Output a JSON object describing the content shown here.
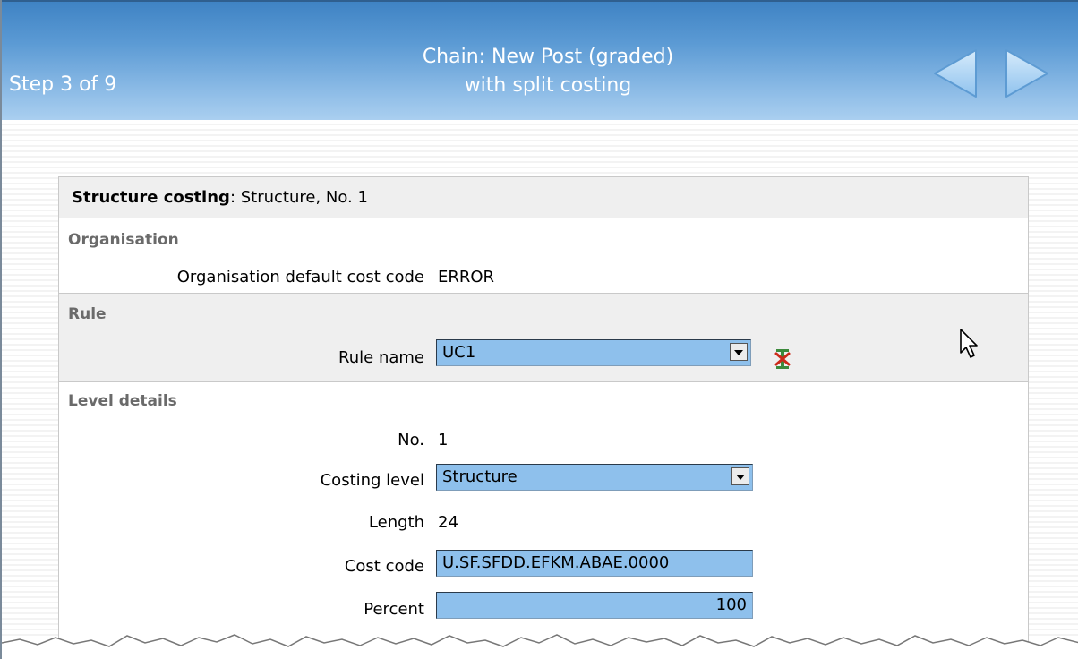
{
  "header": {
    "step_label": "Step 3 of 9",
    "chain_title_line1": "Chain: New Post (graded)",
    "chain_title_line2": "with split costing",
    "prev_icon": "left-arrow-icon",
    "next_icon": "right-arrow-icon"
  },
  "panel": {
    "title_bold": "Structure costing",
    "title_rest": ": Structure, No. 1",
    "organisation": {
      "heading": "Organisation",
      "default_cost_code_label": "Organisation default cost code",
      "default_cost_code_value": "ERROR"
    },
    "rule": {
      "heading": "Rule",
      "rule_name_label": "Rule name",
      "rule_name_value": "UC1",
      "clear_icon": "clear-rule-icon"
    },
    "level_details": {
      "heading": "Level details",
      "no_label": "No.",
      "no_value": "1",
      "costing_level_label": "Costing level",
      "costing_level_value": "Structure",
      "length_label": "Length",
      "length_value": "24",
      "cost_code_label": "Cost code",
      "cost_code_value": "U.SF.SFDD.EFKM.ABAE.0000",
      "percent_label": "Percent",
      "percent_value": "100"
    }
  },
  "colors": {
    "header_top": "#3f83c4",
    "header_bottom": "#aacff0",
    "input_fill": "#8ec0ec",
    "section_heading": "#6a6a6a",
    "band": "#efefef"
  }
}
